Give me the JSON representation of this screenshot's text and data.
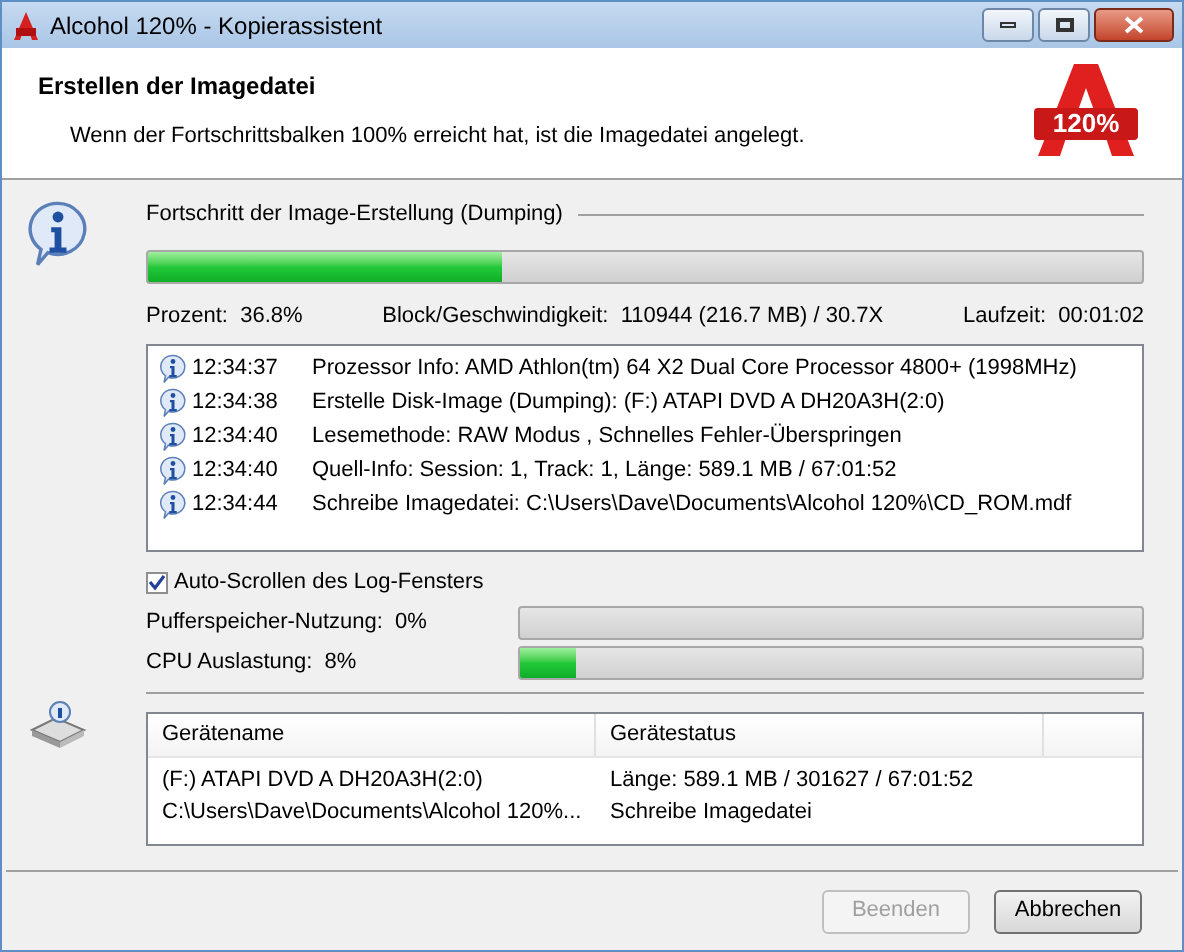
{
  "window": {
    "title": "Alcohol 120% - Kopierassistent"
  },
  "header": {
    "title": "Erstellen der Imagedatei",
    "subtitle": "Wenn der Fortschrittsbalken 100% erreicht hat, ist die Imagedatei angelegt.",
    "logo_text": "120%"
  },
  "progress": {
    "title": "Fortschritt der Image-Erstellung (Dumping)",
    "level": 0.357,
    "stats": [
      {
        "label": "Prozent:",
        "value": "36.8%"
      },
      {
        "label": "Block/Geschwindigkeit:",
        "value": "110944 (216.7 MB) / 30.7X"
      },
      {
        "label": "Laufzeit:",
        "value": "00:01:02"
      }
    ]
  },
  "log": [
    {
      "time": "12:34:37",
      "message": "Prozessor Info: AMD Athlon(tm) 64 X2 Dual Core Processor 4800+ (1998MHz)"
    },
    {
      "time": "12:34:38",
      "message": "Erstelle Disk-Image (Dumping): (F:) ATAPI DVD A  DH20A3H(2:0)"
    },
    {
      "time": "12:34:40",
      "message": "Lesemethode: RAW Modus , Schnelles Fehler-Überspringen"
    },
    {
      "time": "12:34:40",
      "message": "Quell-Info:  Session: 1, Track: 1, Länge: 589.1 MB / 67:01:52"
    },
    {
      "time": "12:34:44",
      "message": "Schreibe Imagedatei: C:\\Users\\Dave\\Documents\\Alcohol 120%\\CD_ROM.mdf"
    }
  ],
  "auto_scroll": {
    "label": "Auto-Scrollen des Log-Fensters",
    "checked": true
  },
  "meters": [
    {
      "label": "Pufferspeicher-Nutzung:",
      "reading": "0%",
      "level": 0
    },
    {
      "label": "CPU Auslastung:",
      "reading": "8%",
      "level": 0.09
    }
  ],
  "devices": {
    "columns": [
      "Gerätename",
      "Gerätestatus"
    ],
    "rows": [
      [
        "(F:) ATAPI DVD A  DH20A3H(2:0)",
        "Länge: 589.1 MB / 301627 / 67:01:52"
      ],
      [
        "C:\\Users\\Dave\\Documents\\Alcohol 120%...",
        "Schreibe Imagedatei"
      ]
    ]
  },
  "buttons": [
    {
      "label": "Beenden",
      "disabled": true
    },
    {
      "label": "Abbrechen",
      "disabled": false
    }
  ]
}
